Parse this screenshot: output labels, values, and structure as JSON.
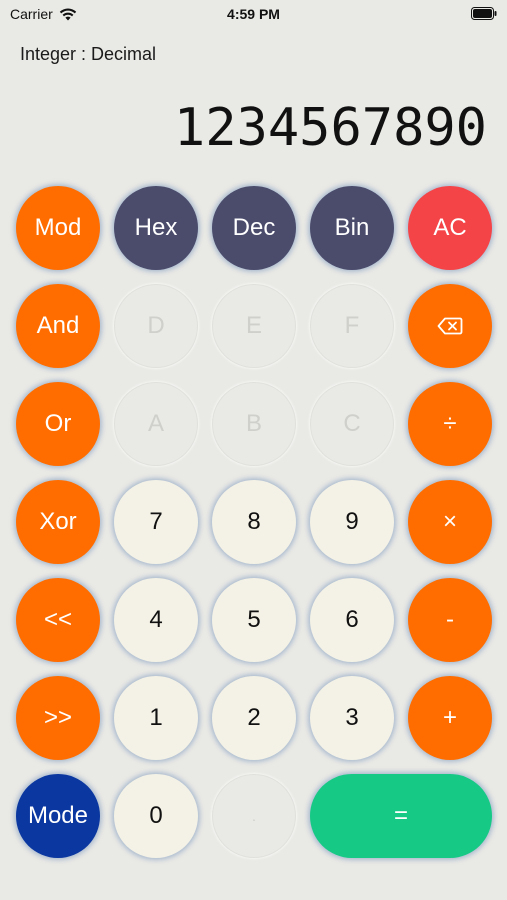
{
  "status_bar": {
    "carrier": "Carrier",
    "time": "4:59 PM",
    "wifi_icon": "wifi-icon",
    "battery_icon": "battery-icon"
  },
  "header": {
    "mode_label": "Integer : Decimal",
    "display_value": "1234567890"
  },
  "colors": {
    "background": "#e9e9e5",
    "operator_orange": "#ff6d00",
    "base_slate": "#4b4c6c",
    "clear_red": "#f44448",
    "digit_cream": "#f4f2e6",
    "mode_blue": "#0a37a0",
    "equals_green": "#16c985"
  },
  "keys": {
    "mod": "Mod",
    "hex": "Hex",
    "dec": "Dec",
    "bin": "Bin",
    "ac": "AC",
    "and": "And",
    "d": "D",
    "e": "E",
    "f": "F",
    "backspace_icon": "backspace-icon",
    "or": "Or",
    "a": "A",
    "b": "B",
    "c": "C",
    "divide": "÷",
    "xor": "Xor",
    "seven": "7",
    "eight": "8",
    "nine": "9",
    "multiply": "×",
    "shift_left": "<<",
    "four": "4",
    "five": "5",
    "six": "6",
    "minus": "-",
    "shift_right": ">>",
    "one": "1",
    "two": "2",
    "three": "3",
    "plus": "+",
    "mode": "Mode",
    "zero": "0",
    "dot": ".",
    "equals": "="
  }
}
